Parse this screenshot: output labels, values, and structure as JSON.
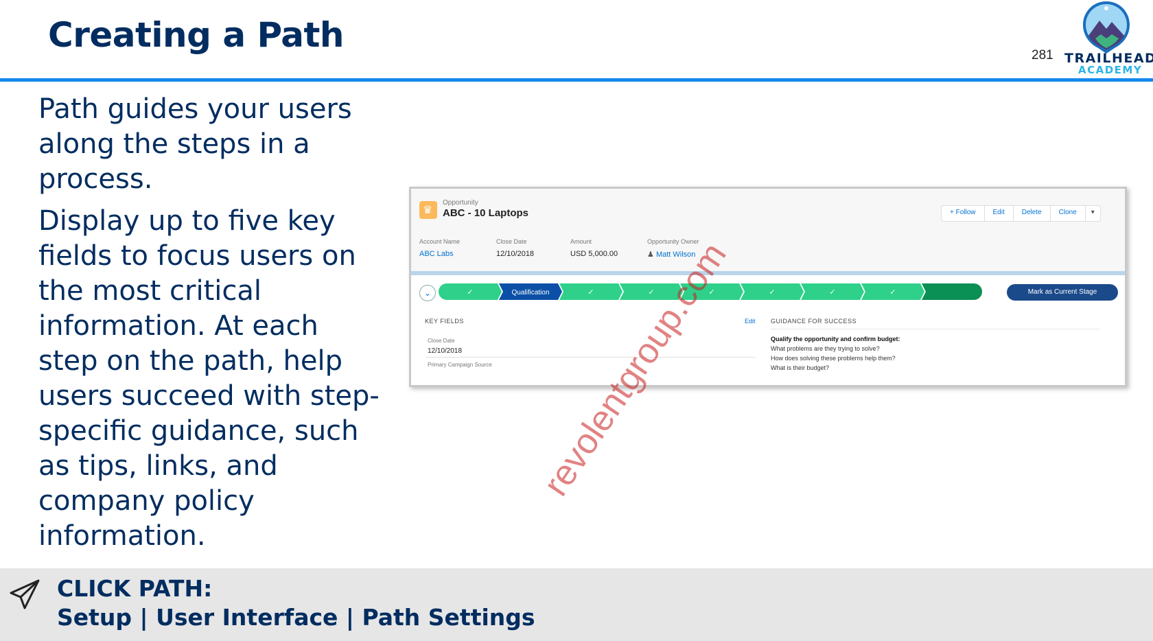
{
  "header": {
    "title": "Creating a Path",
    "page_number": "281",
    "logo_line1": "TRAILHEAD",
    "logo_line2": "ACADEMY"
  },
  "body": {
    "paragraph1": "Path guides your users along the steps in a process.",
    "paragraph2": "Display up to five key fields to focus users on the most critical information. At each step on the path, help users succeed with step-specific guidance, such as tips, links, and company policy information."
  },
  "screenshot": {
    "record_type": "Opportunity",
    "record_title": "ABC - 10 Laptops",
    "buttons": [
      "+ Follow",
      "Edit",
      "Delete",
      "Clone",
      "▾"
    ],
    "fields": [
      {
        "label": "Account Name",
        "value": "ABC Labs"
      },
      {
        "label": "Close Date",
        "value": "12/10/2018"
      },
      {
        "label": "Amount",
        "value": "USD 5,000.00"
      },
      {
        "label": "Opportunity Owner",
        "value": "Matt Wilson"
      }
    ],
    "path": {
      "current_stage": "Qualification",
      "check": "✓",
      "mark_button": "Mark as Current Stage"
    },
    "key_fields": {
      "heading": "KEY FIELDS",
      "edit": "Edit",
      "close_date_label": "Close Date",
      "close_date_value": "12/10/2018",
      "campaign_label": "Primary Campaign Source"
    },
    "guidance": {
      "heading": "GUIDANCE FOR SUCCESS",
      "lines": [
        "Qualify the opportunity and confirm budget:",
        "What problems are they trying to solve?",
        "How does solving these problems help them?",
        "What is their budget?"
      ]
    },
    "colors": {
      "complete": "#2ed08a",
      "current": "#0b50a6",
      "final": "#0a8f55"
    }
  },
  "footer": {
    "label": "CLICK PATH:",
    "path": "Setup | User Interface | Path Settings",
    "icon": "paper-plane-icon"
  },
  "watermark": "revolentgroup.com"
}
